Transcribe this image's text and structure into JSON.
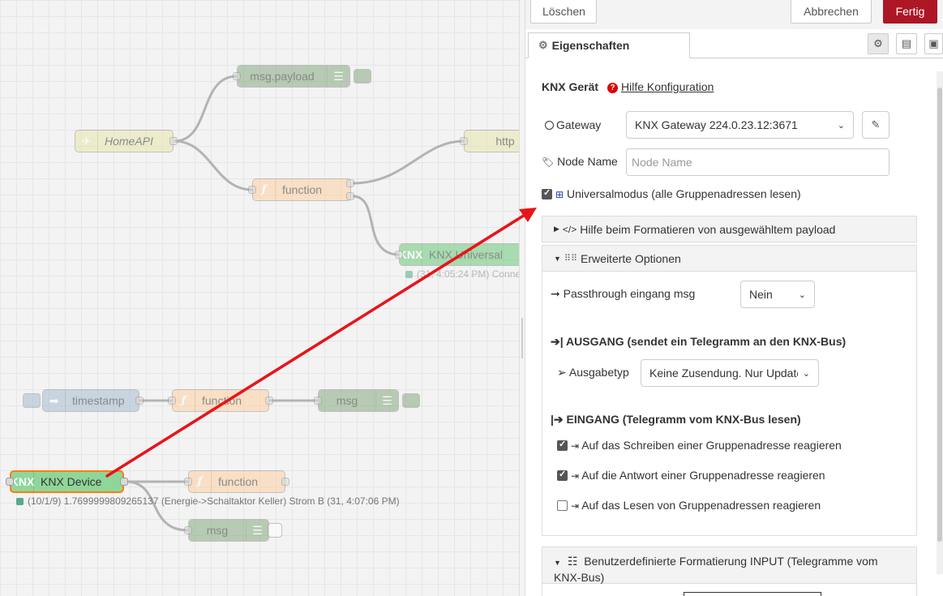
{
  "canvas": {
    "nodes": {
      "msg_payload": "msg.payload",
      "homeapi": "HomeAPI",
      "http": "http",
      "function1": "function",
      "knx_universal": "KNX Universal",
      "knx_universal_status": "(31, 4:05:24 PM) Conne",
      "timestamp": "timestamp",
      "function2": "function",
      "msg1": "msg",
      "knx_device": "KNX Device",
      "knx_device_status": "(10/1/9) 1.7699999809265137 (Energie->Schaltaktor Keller) Strom B (31, 4:07:06 PM)",
      "function3": "function",
      "msg2": "msg",
      "knx_icon_text": "KNX"
    },
    "arrow_color": "#e8141a"
  },
  "tray": {
    "buttons": {
      "delete": "Löschen",
      "cancel": "Abbrechen",
      "done": "Fertig"
    },
    "tab_properties": "Eigenschaften",
    "form": {
      "knx_device_label": "KNX Gerät",
      "help_config": "Hilfe Konfiguration",
      "gateway_label": "Gateway",
      "gateway_value": "KNX Gateway 224.0.23.12:3671",
      "node_name_label": "Node Name",
      "node_name_placeholder": "Node Name",
      "universal_mode": "Universalmodus (alle Gruppenadressen lesen)",
      "universal_mode_checked": true,
      "help_format": "Hilfe beim Formatieren von ausgewähltem payload",
      "advanced_options": "Erweiterte Optionen",
      "passthrough_label": "Passthrough eingang msg",
      "passthrough_value": "Nein",
      "output_heading": "AUSGANG (sendet ein Telegramm an den KNX-Bus)",
      "output_type_label": "Ausgabetyp",
      "output_type_value": "Keine Zusendung. Nur Update",
      "input_heading": "EINGANG (Telegramm vom KNX-Bus lesen)",
      "react_write": "Auf das Schreiben einer Gruppenadresse reagieren",
      "react_write_checked": true,
      "react_response": "Auf die Antwort einer Gruppenadresse reagieren",
      "react_response_checked": true,
      "react_read": "Auf das Lesen von Gruppenadressen reagieren",
      "react_read_checked": false,
      "custom_format": "Benutzerdefinierte Formatierung INPUT (Telegramme vom KNX-Bus)"
    },
    "colors": {
      "primary": "#ad1625",
      "function_node": "#fdd0a2",
      "debug_node": "#87a980",
      "inject_node": "#a6bbcf",
      "knx_node": "#6cc979",
      "http_node": "#e7e7ae"
    }
  }
}
